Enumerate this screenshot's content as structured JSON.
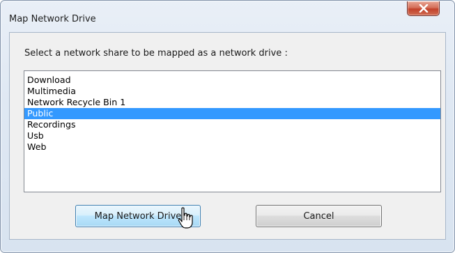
{
  "window": {
    "title": "Map Network Drive",
    "close_icon": "close-x-icon"
  },
  "dialog": {
    "prompt": "Select a network share to be mapped as a network drive :",
    "shares": [
      {
        "label": "Download",
        "selected": false
      },
      {
        "label": "Multimedia",
        "selected": false
      },
      {
        "label": "Network Recycle Bin 1",
        "selected": false
      },
      {
        "label": "Public",
        "selected": true
      },
      {
        "label": "Recordings",
        "selected": false
      },
      {
        "label": "Usb",
        "selected": false
      },
      {
        "label": "Web",
        "selected": false
      }
    ],
    "map_button_label": "Map Network Drive",
    "cancel_button_label": "Cancel"
  },
  "colors": {
    "selection": "#3399ff",
    "close_button": "#c2412a"
  },
  "cursor_icon": "hand-pointer-icon"
}
